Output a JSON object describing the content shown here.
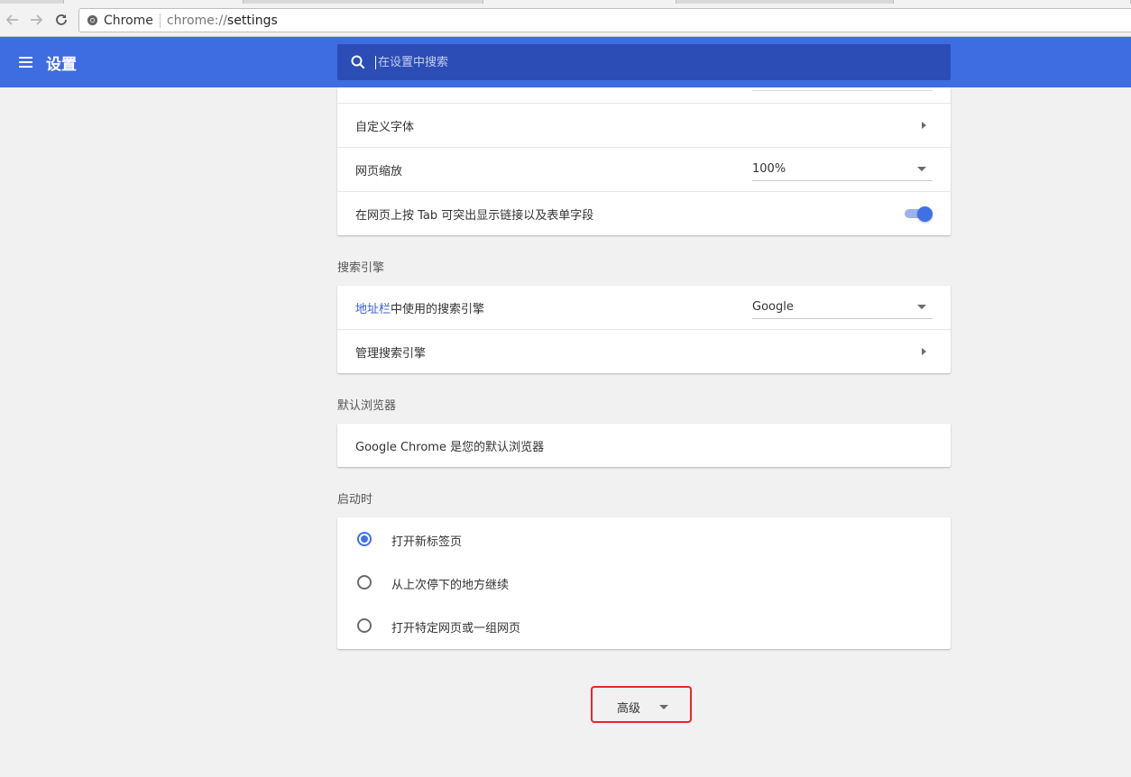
{
  "browser": {
    "site_name": "Chrome",
    "url_scheme": "chrome://",
    "url_host": "settings"
  },
  "header": {
    "title": "设置",
    "search_placeholder": "在设置中搜索",
    "bar_color": "#3d6de0"
  },
  "appearance": {
    "custom_fonts_label": "自定义字体",
    "page_zoom_label": "网页缩放",
    "page_zoom_value": "100%",
    "tab_highlight_label": "在网页上按 Tab 可突出显示链接以及表单字段",
    "tab_highlight_enabled": true
  },
  "search_engine": {
    "section_title": "搜索引擎",
    "address_bar_link": "地址栏",
    "address_bar_suffix": "中使用的搜索引擎",
    "engine_value": "Google",
    "manage_label": "管理搜索引擎"
  },
  "default_browser": {
    "section_title": "默认浏览器",
    "status_text": "Google Chrome 是您的默认浏览器"
  },
  "on_startup": {
    "section_title": "启动时",
    "options": [
      {
        "label": "打开新标签页",
        "checked": true
      },
      {
        "label": "从上次停下的地方继续",
        "checked": false
      },
      {
        "label": "打开特定网页或一组网页",
        "checked": false
      }
    ]
  },
  "advanced": {
    "label": "高级"
  }
}
